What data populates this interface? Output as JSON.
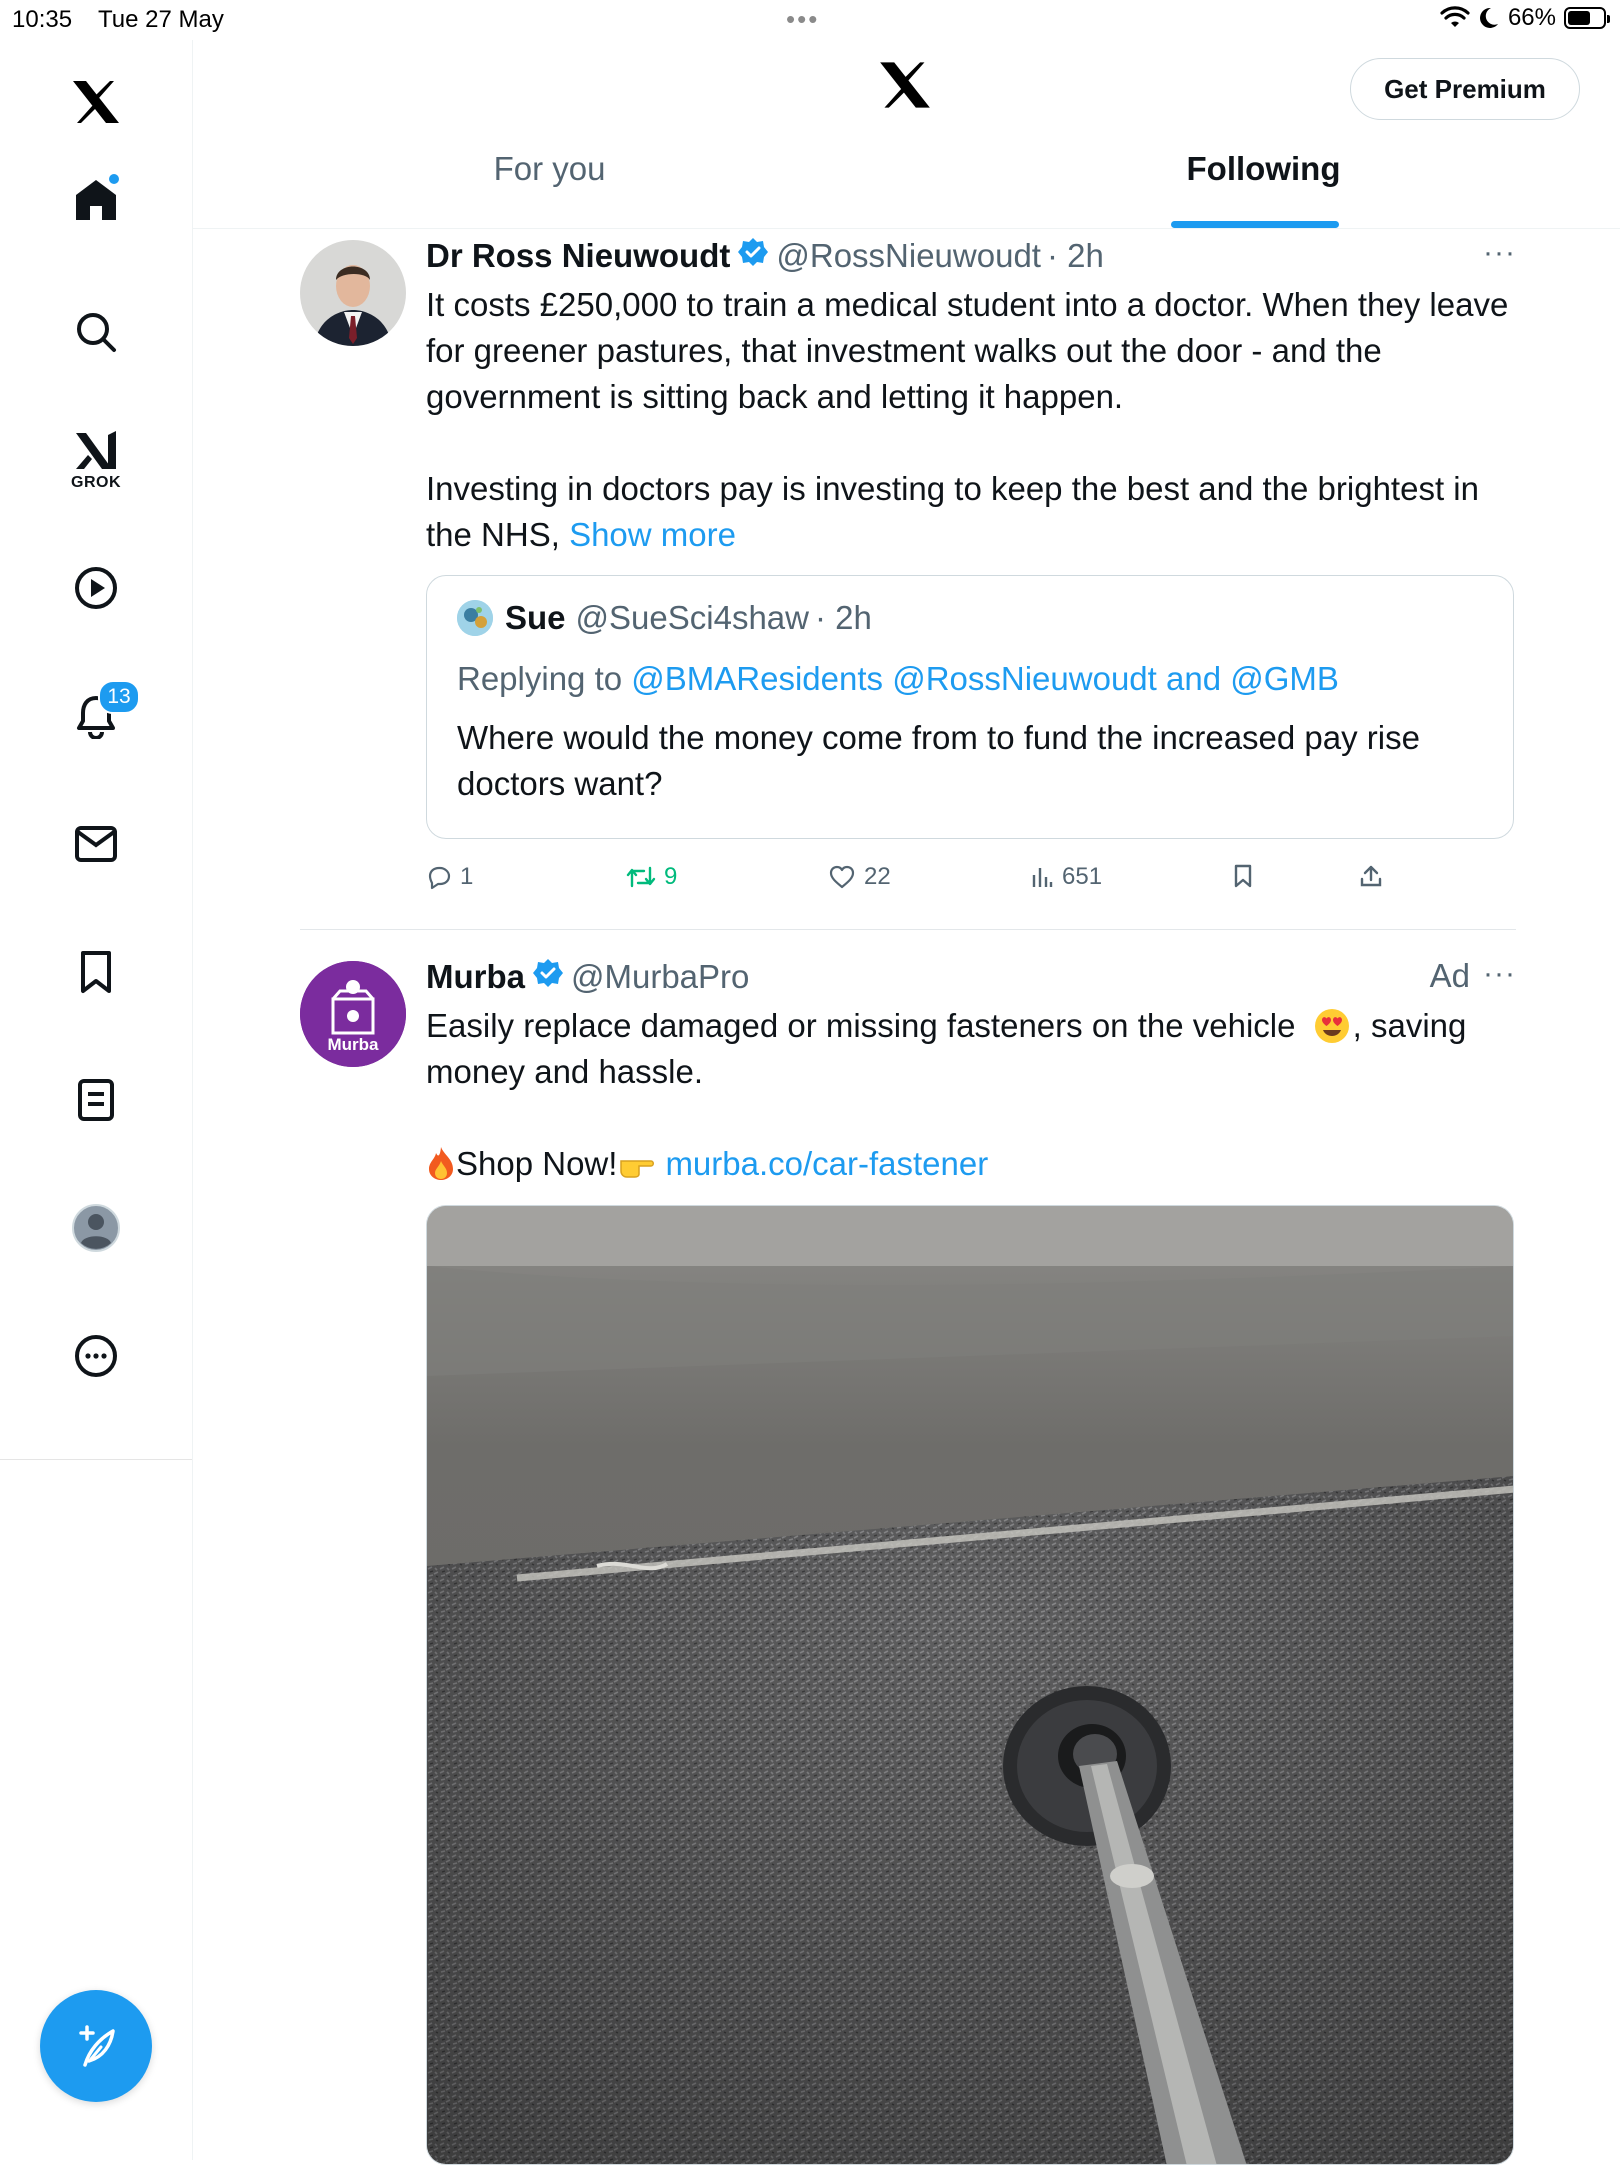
{
  "status_bar": {
    "time": "10:35",
    "date": "Tue 27 May",
    "battery": "66%",
    "battery_level": 0.66
  },
  "sidebar": {
    "items": [
      {
        "name": "home",
        "icon": "home-icon",
        "active": true,
        "has_dot": true
      },
      {
        "name": "explore",
        "icon": "search-icon"
      },
      {
        "name": "grok",
        "icon": "grok-icon",
        "label": "GROK"
      },
      {
        "name": "video",
        "icon": "play-icon"
      },
      {
        "name": "notifications",
        "icon": "bell-icon",
        "badge": "13"
      },
      {
        "name": "messages",
        "icon": "mail-icon"
      },
      {
        "name": "bookmarks",
        "icon": "bookmark-icon"
      },
      {
        "name": "lists",
        "icon": "list-icon"
      },
      {
        "name": "profile",
        "icon": "profile-icon"
      },
      {
        "name": "more",
        "icon": "more-icon"
      }
    ],
    "compose_icon": "compose-icon"
  },
  "header": {
    "premium_label": "Get Premium",
    "tabs": [
      {
        "label": "For you",
        "selected": false
      },
      {
        "label": "Following",
        "selected": true
      }
    ]
  },
  "colors": {
    "accent": "#1d9bf0",
    "text": "#0f1419",
    "secondary": "#536471",
    "retweet": "#00ba7c",
    "murba_brand": "#7b2c9e"
  },
  "tweets": [
    {
      "name": "Dr Ross Nieuwoudt",
      "verified": true,
      "handle": "@RossNieuwoudt",
      "time": "· 2h",
      "more": "···",
      "text_1": "It costs £250,000 to train a medical student into a doctor. When they leave for greener pastures, that investment walks out the door - and the government is sitting back and letting it happen.",
      "text_2": "Investing in doctors pay is investing to keep the best and the brightest in the NHS,",
      "show_more": "Show more",
      "quote": {
        "name": "Sue",
        "handle": "@SueSci4shaw",
        "time": "· 2h",
        "replying_prefix": "Replying to",
        "replying_to": "@BMAResidents @RossNieuwoudt and @GMB",
        "text": "Where would the money come from to fund the increased pay rise doctors want?"
      },
      "actions": {
        "replies": "1",
        "reposts": "9",
        "likes": "22",
        "views": "651"
      }
    },
    {
      "name": "Murba",
      "verified": true,
      "handle": "@MurbaPro",
      "ad_label": "Ad",
      "more": "···",
      "text_1": "Easily replace damaged or missing fasteners on the vehicle",
      "text_1b": ", saving money and hassle.",
      "cta": "Shop Now!",
      "link": "murba.co/car-fastener",
      "avatar_text": "Murba"
    }
  ]
}
